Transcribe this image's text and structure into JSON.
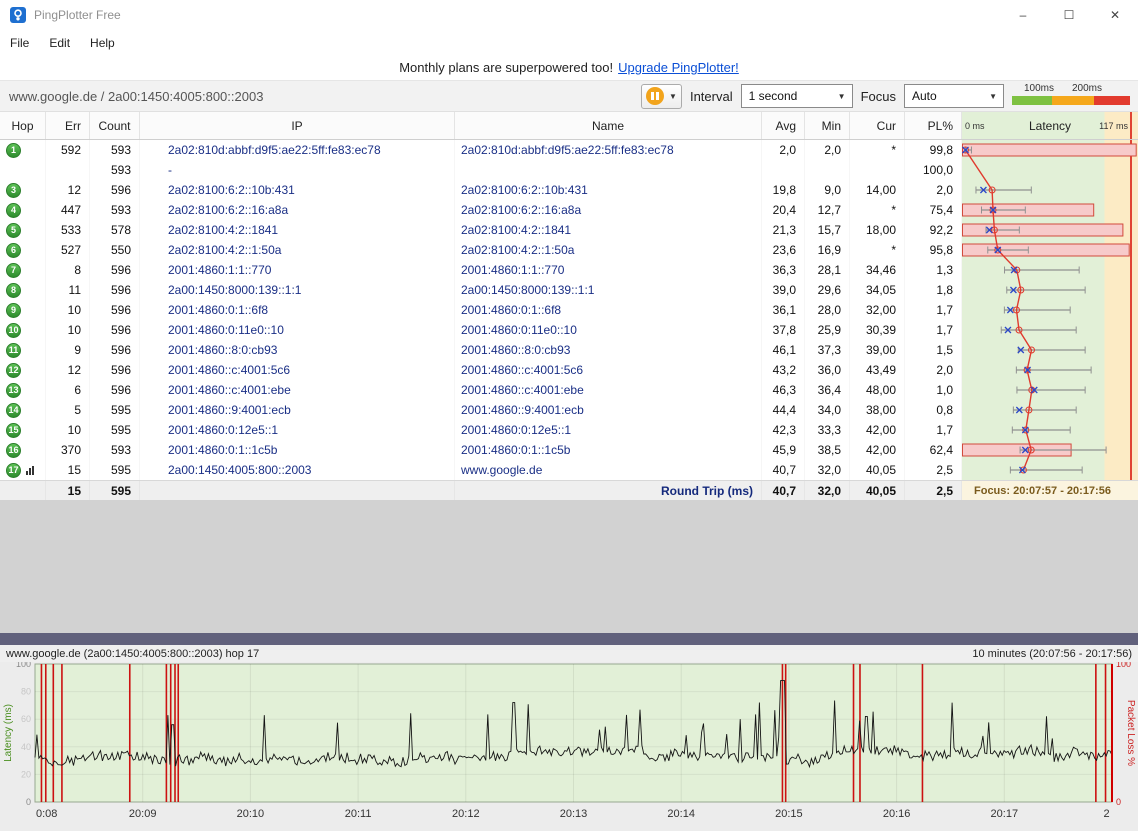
{
  "window": {
    "title": "PingPlotter Free",
    "controls": {
      "minimize": "–",
      "maximize": "☐",
      "close": "✕"
    }
  },
  "menu": {
    "items": [
      "File",
      "Edit",
      "Help"
    ]
  },
  "banner": {
    "text": "Monthly plans are superpowered too!",
    "link": "Upgrade PingPlotter!"
  },
  "toolbar": {
    "target": "www.google.de / 2a00:1450:4005:800::2003",
    "interval_label": "Interval",
    "interval_value": "1 second",
    "focus_label": "Focus",
    "focus_value": "Auto",
    "legend": {
      "labels": [
        "100ms",
        "200ms"
      ],
      "colors": [
        "#7ec142",
        "#f5a81c",
        "#e23b2e"
      ]
    }
  },
  "table": {
    "headers": [
      "Hop",
      "Err",
      "Count",
      "IP",
      "Name",
      "Avg",
      "Min",
      "Cur",
      "PL%"
    ],
    "latency_header": {
      "left": "0 ms",
      "center": "Latency",
      "right": "117 ms"
    },
    "scale_max_ms": 117,
    "rows": [
      {
        "hop": "1",
        "err": "592",
        "count": "593",
        "ip": "2a02:810d:abbf:d9f5:ae22:5ff:fe83:ec78",
        "name": "2a02:810d:abbf:d9f5:ae22:5ff:fe83:ec78",
        "avg": "2,0",
        "min": "2,0",
        "cur": "*",
        "pl": "99,8",
        "wmax": 6
      },
      {
        "hop": "",
        "err": "",
        "count": "593",
        "ip": "-",
        "name": "",
        "avg": "",
        "min": "",
        "cur": "",
        "pl": "100,0",
        "wmax": 0
      },
      {
        "hop": "3",
        "err": "12",
        "count": "596",
        "ip": "2a02:8100:6:2::10b:431",
        "name": "2a02:8100:6:2::10b:431",
        "avg": "19,8",
        "min": "9,0",
        "cur": "14,00",
        "pl": "2,0",
        "wmax": 46
      },
      {
        "hop": "4",
        "err": "447",
        "count": "593",
        "ip": "2a02:8100:6:2::16:a8a",
        "name": "2a02:8100:6:2::16:a8a",
        "avg": "20,4",
        "min": "12,7",
        "cur": "*",
        "pl": "75,4",
        "wmax": 42
      },
      {
        "hop": "5",
        "err": "533",
        "count": "578",
        "ip": "2a02:8100:4:2::1841",
        "name": "2a02:8100:4:2::1841",
        "avg": "21,3",
        "min": "15,7",
        "cur": "18,00",
        "pl": "92,2",
        "wmax": 38
      },
      {
        "hop": "6",
        "err": "527",
        "count": "550",
        "ip": "2a02:8100:4:2::1:50a",
        "name": "2a02:8100:4:2::1:50a",
        "avg": "23,6",
        "min": "16,9",
        "cur": "*",
        "pl": "95,8",
        "wmax": 44
      },
      {
        "hop": "7",
        "err": "8",
        "count": "596",
        "ip": "2001:4860:1:1::770",
        "name": "2001:4860:1:1::770",
        "avg": "36,3",
        "min": "28,1",
        "cur": "34,46",
        "pl": "1,3",
        "wmax": 78
      },
      {
        "hop": "8",
        "err": "11",
        "count": "596",
        "ip": "2a00:1450:8000:139::1:1",
        "name": "2a00:1450:8000:139::1:1",
        "avg": "39,0",
        "min": "29,6",
        "cur": "34,05",
        "pl": "1,8",
        "wmax": 82
      },
      {
        "hop": "9",
        "err": "10",
        "count": "596",
        "ip": "2001:4860:0:1::6f8",
        "name": "2001:4860:0:1::6f8",
        "avg": "36,1",
        "min": "28,0",
        "cur": "32,00",
        "pl": "1,7",
        "wmax": 72
      },
      {
        "hop": "10",
        "err": "10",
        "count": "596",
        "ip": "2001:4860:0:11e0::10",
        "name": "2001:4860:0:11e0::10",
        "avg": "37,8",
        "min": "25,9",
        "cur": "30,39",
        "pl": "1,7",
        "wmax": 76
      },
      {
        "hop": "11",
        "err": "9",
        "count": "596",
        "ip": "2001:4860::8:0:cb93",
        "name": "2001:4860::8:0:cb93",
        "avg": "46,1",
        "min": "37,3",
        "cur": "39,00",
        "pl": "1,5",
        "wmax": 82
      },
      {
        "hop": "12",
        "err": "12",
        "count": "596",
        "ip": "2001:4860::c:4001:5c6",
        "name": "2001:4860::c:4001:5c6",
        "avg": "43,2",
        "min": "36,0",
        "cur": "43,49",
        "pl": "2,0",
        "wmax": 86
      },
      {
        "hop": "13",
        "err": "6",
        "count": "596",
        "ip": "2001:4860::c:4001:ebe",
        "name": "2001:4860::c:4001:ebe",
        "avg": "46,3",
        "min": "36,4",
        "cur": "48,00",
        "pl": "1,0",
        "wmax": 82
      },
      {
        "hop": "14",
        "err": "5",
        "count": "595",
        "ip": "2001:4860::9:4001:ecb",
        "name": "2001:4860::9:4001:ecb",
        "avg": "44,4",
        "min": "34,0",
        "cur": "38,00",
        "pl": "0,8",
        "wmax": 76
      },
      {
        "hop": "15",
        "err": "10",
        "count": "595",
        "ip": "2001:4860:0:12e5::1",
        "name": "2001:4860:0:12e5::1",
        "avg": "42,3",
        "min": "33,3",
        "cur": "42,00",
        "pl": "1,7",
        "wmax": 72
      },
      {
        "hop": "16",
        "err": "370",
        "count": "593",
        "ip": "2001:4860:0:1::1c5b",
        "name": "2001:4860:0:1::1c5b",
        "avg": "45,9",
        "min": "38,5",
        "cur": "42,00",
        "pl": "62,4",
        "wmax": 96
      },
      {
        "hop": "17",
        "err": "15",
        "count": "595",
        "ip": "2a00:1450:4005:800::2003",
        "name": "www.google.de",
        "avg": "40,7",
        "min": "32,0",
        "cur": "40,05",
        "pl": "2,5",
        "wmax": 80,
        "focused": true
      }
    ],
    "round_trip": {
      "err": "15",
      "count": "595",
      "label": "Round Trip (ms)",
      "avg": "40,7",
      "min": "32,0",
      "cur": "40,05",
      "pl": "2,5",
      "focus": "Focus: 20:07:57 - 20:17:56"
    }
  },
  "bottom": {
    "header_left": "www.google.de (2a00:1450:4005:800::2003) hop 17",
    "header_right": "10 minutes (20:07:56 - 20:17:56)",
    "y_left_label": "Latency (ms)",
    "y_right_label": "Packet Loss %",
    "y_left_ticks": [
      100,
      80,
      60,
      40,
      20,
      0
    ],
    "y_right_ticks": [
      100,
      0
    ],
    "x_ticks": {
      "labels": [
        "0:08",
        "20:09",
        "20:10",
        "20:11",
        "20:12",
        "20:13",
        "20:14",
        "20:15",
        "20:16",
        "20:17",
        "2"
      ],
      "fracs": [
        0.0,
        0.1,
        0.2,
        0.3,
        0.4,
        0.5,
        0.6,
        0.7,
        0.8,
        0.9,
        0.995
      ]
    },
    "chart": {
      "type": "line",
      "ylim": [
        0,
        100
      ],
      "loss_fracs": [
        0.006,
        0.01,
        0.017,
        0.025,
        0.088,
        0.122,
        0.126,
        0.13,
        0.133,
        0.694,
        0.697,
        0.76,
        0.766,
        0.824,
        0.985,
        0.994
      ],
      "spikes": [
        {
          "f": 0.128,
          "v": 56
        },
        {
          "f": 0.445,
          "v": 72
        },
        {
          "f": 0.694,
          "v": 88
        },
        {
          "f": 0.772,
          "v": 62
        }
      ],
      "n_points": 560,
      "seed": 13
    }
  },
  "colors": {
    "latency_ok_bg": "#e2f0d7",
    "latency_warn_bg": "#fcebc5",
    "loss_bar_fill": "#f7caca",
    "loss_bar_border": "#d24a3c",
    "avg_line": "#e03a2e",
    "cur_mark": "#2b48c8",
    "whisker": "#909090",
    "loss_event_line": "#cc1111",
    "trace": "#141414"
  }
}
